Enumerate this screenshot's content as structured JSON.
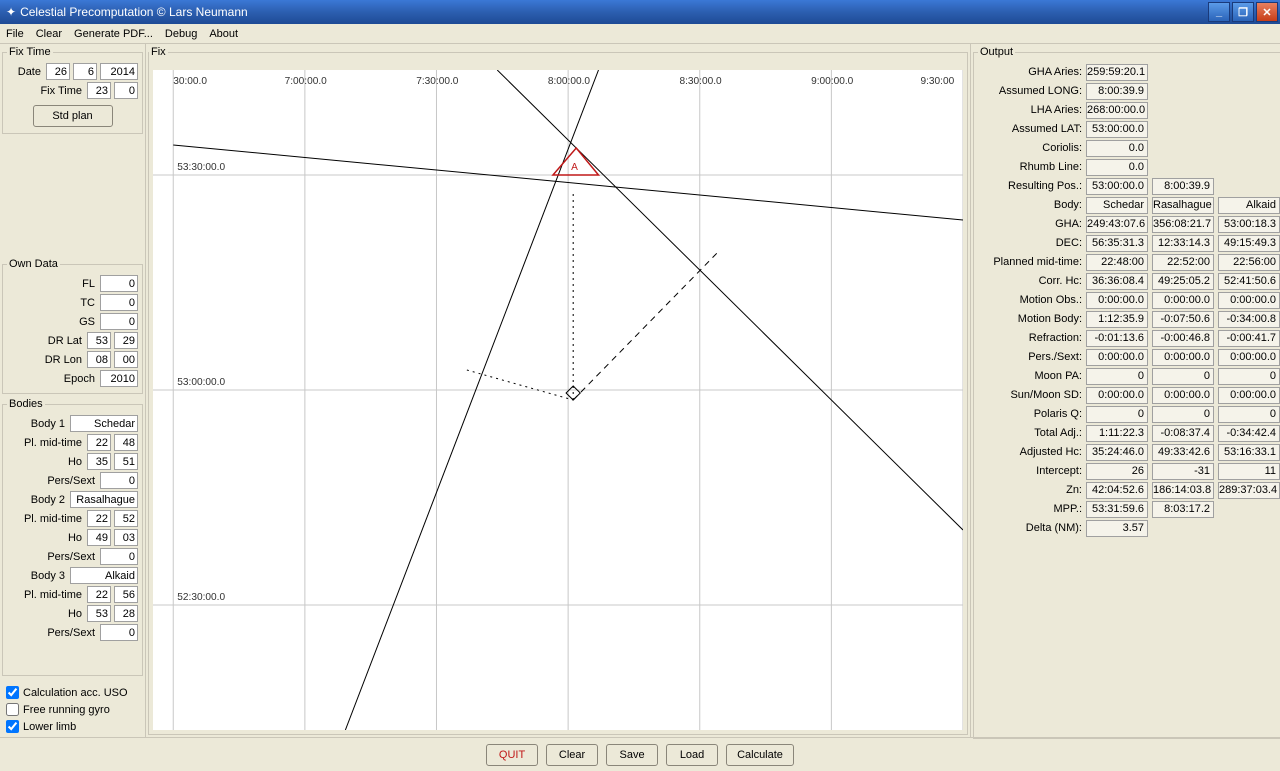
{
  "window": {
    "title": "Celestial Precomputation © Lars Neumann"
  },
  "menubar": {
    "file": "File",
    "clear": "Clear",
    "genpdf": "Generate PDF...",
    "debug": "Debug",
    "about": "About"
  },
  "fixtime": {
    "legend": "Fix Time",
    "date_label": "Date",
    "date_d": "26",
    "date_m": "6",
    "date_y": "2014",
    "time_label": "Fix Time",
    "time_h": "23",
    "time_m": "0",
    "stdplan": "Std plan"
  },
  "owndata": {
    "legend": "Own Data",
    "fl_label": "FL",
    "fl": "0",
    "tc_label": "TC",
    "tc": "0",
    "gs_label": "GS",
    "gs": "0",
    "drlat_label": "DR Lat",
    "drlat_d": "53",
    "drlat_m": "29",
    "drlon_label": "DR Lon",
    "drlon_d": "08",
    "drlon_m": "00",
    "epoch_label": "Epoch",
    "epoch": "2010"
  },
  "bodies": {
    "legend": "Bodies",
    "b1": {
      "label": "Body 1",
      "name": "Schedar",
      "midtime_label": "Pl. mid-time",
      "mt_h": "22",
      "mt_m": "48",
      "ho_label": "Ho",
      "ho_d": "35",
      "ho_m": "51",
      "ps_label": "Pers/Sext",
      "ps": "0"
    },
    "b2": {
      "label": "Body 2",
      "name": "Rasalhague",
      "midtime_label": "Pl. mid-time",
      "mt_h": "22",
      "mt_m": "52",
      "ho_label": "Ho",
      "ho_d": "49",
      "ho_m": "03",
      "ps_label": "Pers/Sext",
      "ps": "0"
    },
    "b3": {
      "label": "Body 3",
      "name": "Alkaid",
      "midtime_label": "Pl. mid-time",
      "mt_h": "22",
      "mt_m": "56",
      "ho_label": "Ho",
      "ho_d": "53",
      "ho_m": "28",
      "ps_label": "Pers/Sext",
      "ps": "0"
    }
  },
  "checks": {
    "uso": "Calculation acc. USO",
    "uso_checked": true,
    "gyro": "Free running gyro",
    "gyro_checked": false,
    "limb": "Lower limb",
    "limb_checked": true
  },
  "plot": {
    "legend": "Fix",
    "xticks": [
      "30:00.0",
      "7:00:00.0",
      "7:30:00.0",
      "8:00:00.0",
      "8:30:00.0",
      "9:00:00.0",
      "9:30:00"
    ],
    "yticks": [
      "53:30:00.0",
      "53:00:00.0",
      "52:30:00.0"
    ],
    "tri_label": "A"
  },
  "output": {
    "legend": "Output",
    "rows": [
      {
        "label": "GHA Aries:",
        "cells": [
          "259:59:20.1"
        ]
      },
      {
        "label": "Assumed LONG:",
        "cells": [
          "8:00:39.9"
        ]
      },
      {
        "label": "LHA Aries:",
        "cells": [
          "268:00:00.0"
        ]
      },
      {
        "label": "Assumed LAT:",
        "cells": [
          "53:00:00.0"
        ]
      },
      {
        "label": "Coriolis:",
        "cells": [
          "0.0"
        ]
      },
      {
        "label": "Rhumb Line:",
        "cells": [
          "0.0"
        ]
      },
      {
        "label": "Resulting Pos.:",
        "cells": [
          "53:00:00.0",
          "8:00:39.9"
        ]
      },
      {
        "label": "Body:",
        "cells": [
          "Schedar",
          "Rasalhague",
          "Alkaid"
        ]
      },
      {
        "label": "GHA:",
        "cells": [
          "249:43:07.6",
          "356:08:21.7",
          "53:00:18.3"
        ]
      },
      {
        "label": "DEC:",
        "cells": [
          "56:35:31.3",
          "12:33:14.3",
          "49:15:49.3"
        ]
      },
      {
        "label": "Planned mid-time:",
        "cells": [
          "22:48:00",
          "22:52:00",
          "22:56:00"
        ]
      },
      {
        "label": "Corr. Hc:",
        "cells": [
          "36:36:08.4",
          "49:25:05.2",
          "52:41:50.6"
        ]
      },
      {
        "label": "Motion Obs.:",
        "cells": [
          "0:00:00.0",
          "0:00:00.0",
          "0:00:00.0"
        ]
      },
      {
        "label": "Motion Body:",
        "cells": [
          "1:12:35.9",
          "-0:07:50.6",
          "-0:34:00.8"
        ]
      },
      {
        "label": "Refraction:",
        "cells": [
          "-0:01:13.6",
          "-0:00:46.8",
          "-0:00:41.7"
        ]
      },
      {
        "label": "Pers./Sext:",
        "cells": [
          "0:00:00.0",
          "0:00:00.0",
          "0:00:00.0"
        ]
      },
      {
        "label": "Moon PA:",
        "cells": [
          "0",
          "0",
          "0"
        ]
      },
      {
        "label": "Sun/Moon SD:",
        "cells": [
          "0:00:00.0",
          "0:00:00.0",
          "0:00:00.0"
        ]
      },
      {
        "label": "Polaris Q:",
        "cells": [
          "0",
          "0",
          "0"
        ]
      },
      {
        "label": "Total Adj.:",
        "cells": [
          "1:11:22.3",
          "-0:08:37.4",
          "-0:34:42.4"
        ]
      },
      {
        "label": "Adjusted Hc:",
        "cells": [
          "35:24:46.0",
          "49:33:42.6",
          "53:16:33.1"
        ]
      },
      {
        "label": "Intercept:",
        "cells": [
          "26",
          "-31",
          "11"
        ]
      },
      {
        "label": "Zn:",
        "cells": [
          "42:04:52.6",
          "186:14:03.8",
          "289:37:03.4"
        ]
      },
      {
        "label": "MPP.:",
        "cells": [
          "53:31:59.6",
          "8:03:17.2"
        ]
      },
      {
        "label": "Delta (NM):",
        "cells": [
          "3.57"
        ]
      }
    ]
  },
  "buttons": {
    "quit": "QUIT",
    "clear": "Clear",
    "save": "Save",
    "load": "Load",
    "calc": "Calculate"
  }
}
